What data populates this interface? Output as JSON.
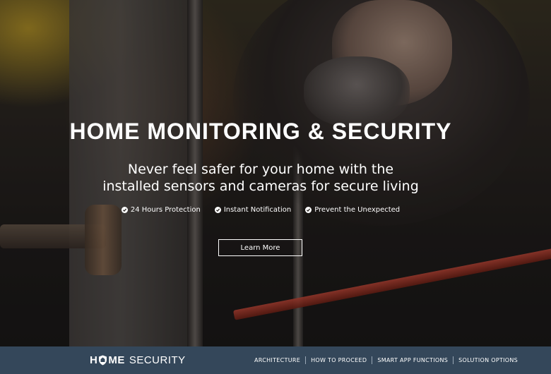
{
  "hero": {
    "headline": "HOME MONITORING & SECURITY",
    "subhead_line1": "Never feel safer for your home with the",
    "subhead_line2": "installed sensors and cameras for secure living",
    "features": [
      {
        "icon": "check-circle-icon",
        "label": "24 Hours Protection"
      },
      {
        "icon": "check-circle-icon",
        "label": "Instant Notification"
      },
      {
        "icon": "check-circle-icon",
        "label": "Prevent the Unexpected"
      }
    ],
    "cta_label": "Learn More"
  },
  "navbar": {
    "brand_bold_left": "H",
    "brand_bold_right": "ME",
    "brand_light": "SECURITY",
    "brand_icon": "shield-icon",
    "items": [
      "ARCHITECTURE",
      "HOW TO PROCEED",
      "SMART APP FUNCTIONS",
      "SOLUTION OPTIONS"
    ],
    "background_color": "#34475a"
  },
  "colors": {
    "text": "#ffffff",
    "nav_background": "#34475a"
  }
}
